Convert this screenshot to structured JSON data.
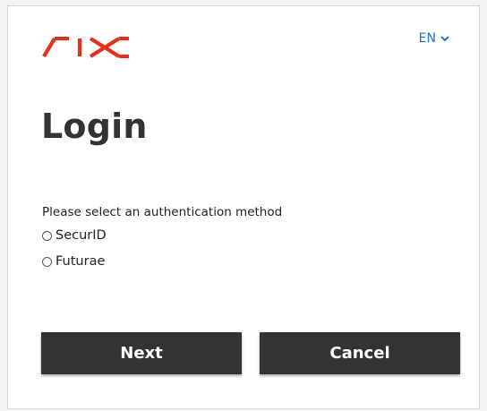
{
  "brand": {
    "logo_text": "SIX",
    "logo_color": "#e2311d"
  },
  "language": {
    "selected": "EN",
    "accent_color": "#1a73c9",
    "icon": "chevron-down-icon"
  },
  "login": {
    "title": "Login",
    "prompt": "Please select an authentication method",
    "methods": [
      {
        "label": "SecurID",
        "selected": false
      },
      {
        "label": "Futurae",
        "selected": false
      }
    ]
  },
  "actions": {
    "next_label": "Next",
    "cancel_label": "Cancel",
    "button_color": "#333333"
  }
}
